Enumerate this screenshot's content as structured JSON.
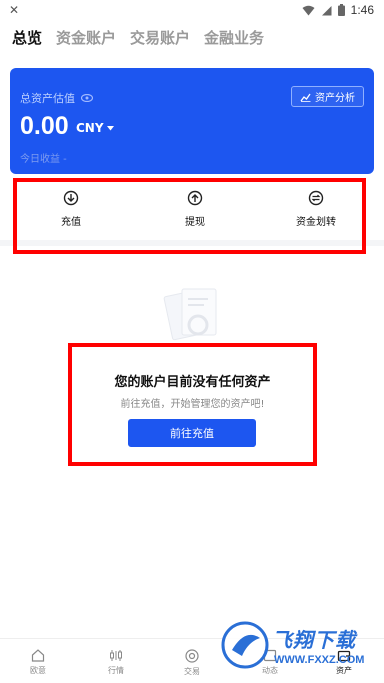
{
  "status_bar": {
    "time": "1:46"
  },
  "tabs": [
    {
      "label": "总览",
      "active": true
    },
    {
      "label": "资金账户",
      "active": false
    },
    {
      "label": "交易账户",
      "active": false
    },
    {
      "label": "金融业务",
      "active": false
    }
  ],
  "asset_card": {
    "label": "总资产估值",
    "value": "0.00",
    "currency": "CNY",
    "income_label": "今日收益 -",
    "analysis_label": "资产分析",
    "background_color": "#1d56f0"
  },
  "actions": [
    {
      "label": "充值",
      "icon": "deposit-icon"
    },
    {
      "label": "提现",
      "icon": "withdraw-icon"
    },
    {
      "label": "资金划转",
      "icon": "transfer-icon"
    }
  ],
  "empty_state": {
    "title": "您的账户目前没有任何资产",
    "subtitle": "前往充值，开始管理您的资产吧!",
    "button_label": "前往充值"
  },
  "bottom_nav": [
    {
      "label": "欧意",
      "icon": "home-icon"
    },
    {
      "label": "行情",
      "icon": "market-icon"
    },
    {
      "label": "交易",
      "icon": "trade-icon"
    },
    {
      "label": "动态",
      "icon": "feed-icon"
    },
    {
      "label": "资产",
      "icon": "wallet-icon"
    }
  ],
  "watermark": {
    "text": "飞翔下载",
    "url": "WWW.FXXZ.COM"
  },
  "colors": {
    "accent": "#1d56f0",
    "highlight_border": "#ff0000"
  }
}
